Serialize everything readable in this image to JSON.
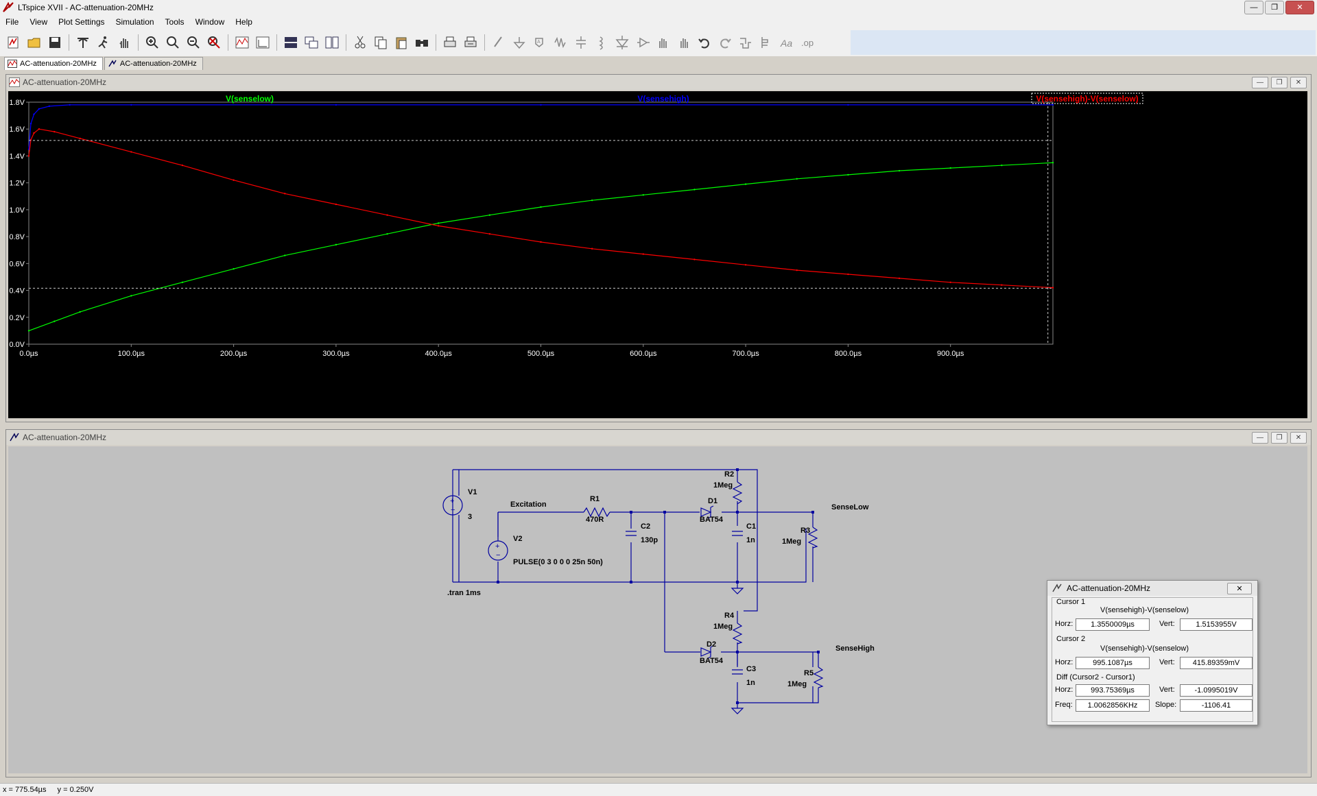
{
  "app": {
    "window_title": "LTspice XVII - AC-attenuation-20MHz"
  },
  "menu": [
    "File",
    "View",
    "Plot Settings",
    "Simulation",
    "Tools",
    "Window",
    "Help"
  ],
  "toolbar_icons": [
    "open-schematic-icon",
    "open-file-icon",
    "save-icon",
    "control-panel-icon",
    "run-icon",
    "pan-hand-icon",
    "zoom-in-icon",
    "zoom-area-icon",
    "zoom-out-icon",
    "zoom-fit-icon",
    "autorange-icon",
    "plot-settings-icon",
    "tile-horizontal-icon",
    "cascade-icon",
    "tile-vertical-icon",
    "cut-icon",
    "copy-icon",
    "paste-icon",
    "find-icon",
    "print-icon",
    "print-setup-icon",
    "wire-icon",
    "ground-icon",
    "label-net-icon",
    "resistor-icon",
    "capacitor-icon",
    "inductor-icon",
    "diode-icon",
    "component-icon",
    "move-icon",
    "drag-icon",
    "undo-icon",
    "redo-icon",
    "rotate-icon",
    "mirror-icon",
    "text-icon",
    "spice-directive-icon"
  ],
  "tabs": [
    {
      "label": "AC-attenuation-20MHz",
      "icon": "waveform-icon",
      "active": true
    },
    {
      "label": "AC-attenuation-20MHz",
      "icon": "schematic-icon",
      "active": false
    }
  ],
  "plot_window": {
    "title": "AC-attenuation-20MHz",
    "legend": [
      {
        "name": "V(senselow)",
        "color": "#00ff00"
      },
      {
        "name": "V(sensehigh)",
        "color": "#0000ff"
      },
      {
        "name": "V(sensehigh)-V(senselow)",
        "color": "#ff0000"
      }
    ]
  },
  "chart_data": {
    "type": "line",
    "x_unit": "µs",
    "y_unit": "V",
    "xlim": [
      0,
      1000
    ],
    "ylim": [
      0,
      1.8
    ],
    "x_ticks": [
      "0.0µs",
      "100.0µs",
      "200.0µs",
      "300.0µs",
      "400.0µs",
      "500.0µs",
      "600.0µs",
      "700.0µs",
      "800.0µs",
      "900.0µs"
    ],
    "y_ticks": [
      "0.0V",
      "0.2V",
      "0.4V",
      "0.6V",
      "0.8V",
      "1.0V",
      "1.2V",
      "1.4V",
      "1.6V",
      "1.8V"
    ],
    "series": [
      {
        "name": "V(senselow)",
        "color": "#00ff00",
        "x": [
          0,
          25,
          50,
          100,
          150,
          200,
          250,
          300,
          350,
          400,
          450,
          500,
          550,
          600,
          650,
          700,
          750,
          800,
          850,
          900,
          950,
          1000
        ],
        "y": [
          0.1,
          0.17,
          0.24,
          0.36,
          0.46,
          0.56,
          0.66,
          0.74,
          0.82,
          0.9,
          0.96,
          1.02,
          1.07,
          1.11,
          1.15,
          1.19,
          1.23,
          1.26,
          1.29,
          1.31,
          1.33,
          1.35
        ]
      },
      {
        "name": "V(sensehigh)",
        "color": "#0000ff",
        "x": [
          0,
          2,
          5,
          10,
          20,
          40,
          100,
          300,
          500,
          800,
          1000
        ],
        "y": [
          1.45,
          1.64,
          1.71,
          1.75,
          1.77,
          1.78,
          1.78,
          1.78,
          1.78,
          1.78,
          1.78
        ]
      },
      {
        "name": "V(sensehigh)-V(senselow)",
        "color": "#ff0000",
        "x": [
          0,
          2,
          5,
          10,
          25,
          50,
          100,
          150,
          200,
          250,
          300,
          350,
          400,
          450,
          500,
          550,
          600,
          650,
          700,
          750,
          800,
          850,
          900,
          950,
          1000
        ],
        "y": [
          1.4,
          1.52,
          1.57,
          1.6,
          1.58,
          1.53,
          1.43,
          1.33,
          1.22,
          1.12,
          1.04,
          0.96,
          0.88,
          0.82,
          0.76,
          0.71,
          0.67,
          0.63,
          0.59,
          0.55,
          0.52,
          0.49,
          0.46,
          0.44,
          0.42
        ]
      }
    ],
    "cursors": {
      "v1": 1.515,
      "v2": 0.416,
      "h2": 995.1
    }
  },
  "schematic": {
    "title": "AC-attenuation-20MHz",
    "components": {
      "V1": {
        "name": "V1",
        "value": "3"
      },
      "V2": {
        "name": "V2",
        "value": "PULSE(0 3 0 0 0 25n 50n)"
      },
      "R1": {
        "name": "R1",
        "value": "470R"
      },
      "R2": {
        "name": "R2",
        "value": "1Meg"
      },
      "R3": {
        "name": "R3",
        "value": "1Meg"
      },
      "R4": {
        "name": "R4",
        "value": "1Meg"
      },
      "R5": {
        "name": "R5",
        "value": "1Meg"
      },
      "C1": {
        "name": "C1",
        "value": "1n"
      },
      "C2": {
        "name": "C2",
        "value": "130p"
      },
      "C3": {
        "name": "C3",
        "value": "1n"
      },
      "D1": {
        "name": "D1",
        "value": "BAT54"
      },
      "D2": {
        "name": "D2",
        "value": "BAT54"
      }
    },
    "nets": {
      "excitation": "Excitation",
      "senselow": "SenseLow",
      "sensehigh": "SenseHigh"
    },
    "directive": ".tran 1ms"
  },
  "cursor_panel": {
    "title": "AC-attenuation-20MHz",
    "cursor1": {
      "label": "Cursor 1",
      "trace": "V(sensehigh)-V(senselow)",
      "horz_label": "Horz:",
      "horz": "1.3550009µs",
      "vert_label": "Vert:",
      "vert": "1.5153955V"
    },
    "cursor2": {
      "label": "Cursor 2",
      "trace": "V(sensehigh)-V(senselow)",
      "horz_label": "Horz:",
      "horz": "995.1087µs",
      "vert_label": "Vert:",
      "vert": "415.89359mV"
    },
    "diff": {
      "label": "Diff (Cursor2 - Cursor1)",
      "horz_label": "Horz:",
      "horz": "993.75369µs",
      "vert_label": "Vert:",
      "vert": "-1.0995019V",
      "freq_label": "Freq:",
      "freq": "1.0062856KHz",
      "slope_label": "Slope:",
      "slope": "-1106.41"
    }
  },
  "status": {
    "x": "x = 775.54µs",
    "y": "y = 0.250V"
  }
}
